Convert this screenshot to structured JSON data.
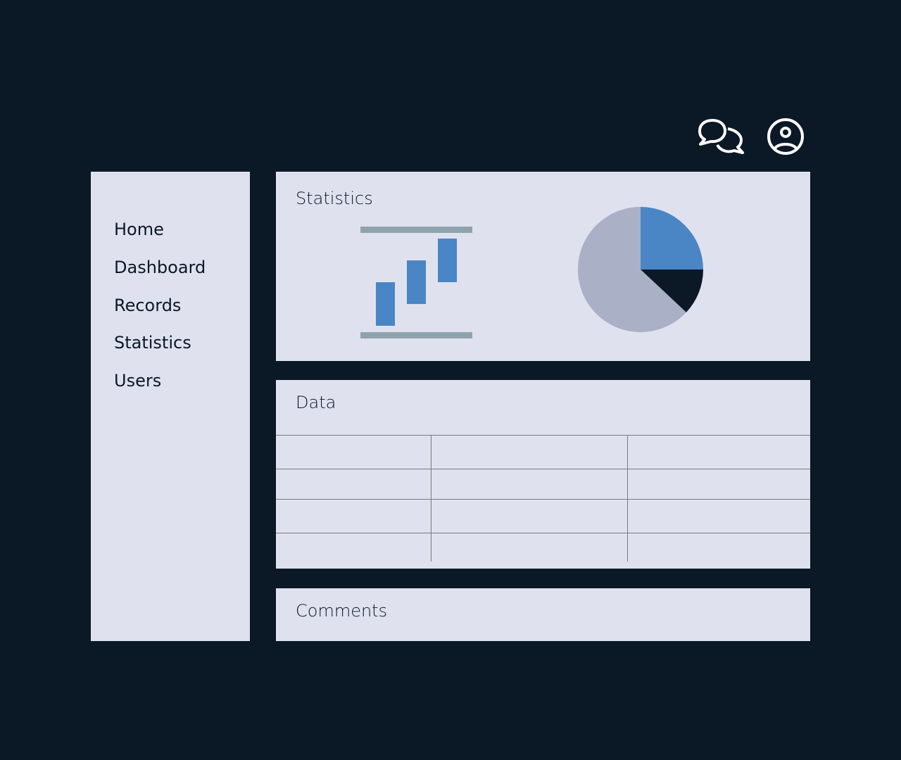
{
  "header": {
    "icons": [
      "chat-bubbles-icon",
      "user-circle-icon"
    ]
  },
  "sidebar": {
    "items": [
      {
        "label": "Home"
      },
      {
        "label": "Dashboard"
      },
      {
        "label": "Records"
      },
      {
        "label": "Statistics"
      },
      {
        "label": "Users"
      }
    ]
  },
  "statistics": {
    "title": "Statistics",
    "bars_chart": {
      "type": "bar",
      "bars": [
        {
          "low": 1,
          "high": 3
        },
        {
          "low": 2,
          "high": 4
        },
        {
          "low": 3,
          "high": 5
        }
      ]
    },
    "pie_chart": {
      "type": "pie",
      "slices": [
        {
          "value": 0.25,
          "color": "#4a86c5"
        },
        {
          "value": 0.12,
          "color": "#0b1826"
        },
        {
          "value": 0.63,
          "color": "#aab0c6"
        }
      ]
    }
  },
  "data": {
    "title": "Data",
    "rows": [
      [
        "",
        "",
        ""
      ],
      [
        "",
        "",
        ""
      ],
      [
        "",
        "",
        ""
      ],
      [
        "",
        "",
        ""
      ]
    ]
  },
  "comments": {
    "title": "Comments"
  },
  "colors": {
    "background": "#0b1826",
    "panel": "#dfe2ee",
    "accent": "#4a86c5",
    "rule": "#8fa3ae"
  }
}
